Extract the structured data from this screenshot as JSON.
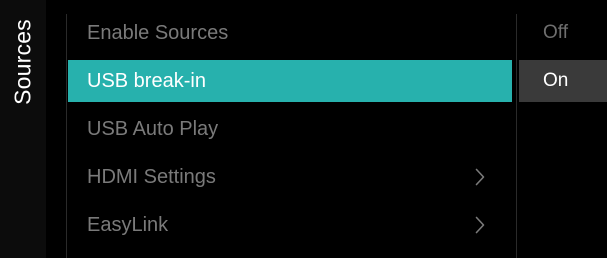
{
  "side_panel": {
    "title": "Sources"
  },
  "menu": {
    "items": [
      {
        "label": "Enable Sources",
        "has_submenu": false,
        "selected": false
      },
      {
        "label": "USB break-in",
        "has_submenu": false,
        "selected": true
      },
      {
        "label": "USB Auto Play",
        "has_submenu": false,
        "selected": false
      },
      {
        "label": "HDMI Settings",
        "has_submenu": true,
        "selected": false
      },
      {
        "label": "EasyLink",
        "has_submenu": true,
        "selected": false
      }
    ]
  },
  "options": {
    "items": [
      {
        "label": "Off",
        "current": false
      },
      {
        "label": "On",
        "current": true
      }
    ]
  },
  "colors": {
    "accent": "#27b1ad",
    "background": "#000000",
    "inactive_text": "#7a7a7a",
    "option_highlight": "#3a3a3a"
  },
  "icons": {
    "submenu": "chevron-right-icon"
  }
}
